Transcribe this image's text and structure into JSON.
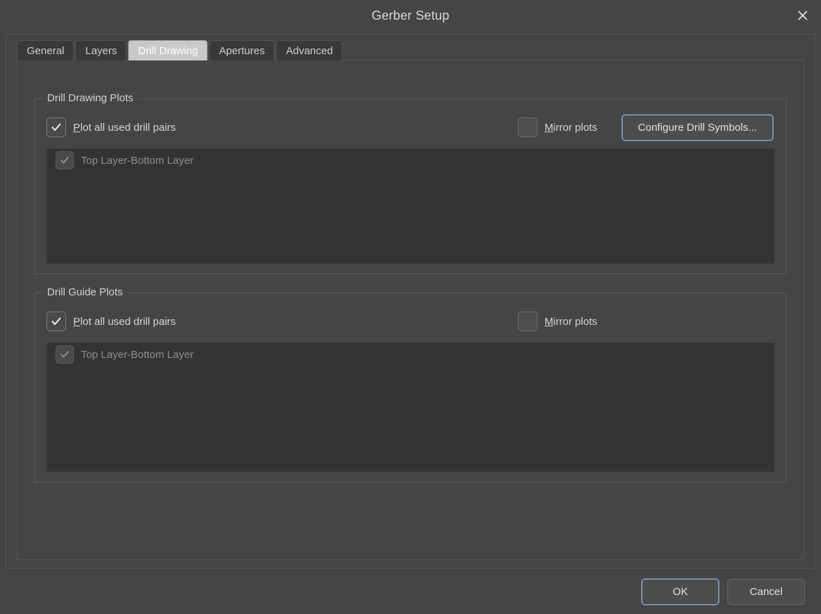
{
  "window": {
    "title": "Gerber Setup",
    "close_icon": "close-icon"
  },
  "tabs": [
    {
      "label": "General",
      "active": false
    },
    {
      "label": "Layers",
      "active": false
    },
    {
      "label": "Drill Drawing",
      "active": true
    },
    {
      "label": "Apertures",
      "active": false
    },
    {
      "label": "Advanced",
      "active": false
    }
  ],
  "drill_drawing_plots": {
    "title": "Drill Drawing Plots",
    "plot_all": {
      "label_prefix": "",
      "accel": "P",
      "label_rest": "lot all used drill pairs",
      "checked": true
    },
    "mirror": {
      "accel": "M",
      "label_rest": "irror plots",
      "checked": false
    },
    "configure_button": "Configure Drill Symbols...",
    "list": [
      {
        "label": "Top Layer-Bottom Layer",
        "checked": true,
        "disabled": true
      }
    ]
  },
  "drill_guide_plots": {
    "title": "Drill Guide Plots",
    "plot_all": {
      "accel": "P",
      "label_rest": "lot all used drill pairs",
      "checked": true
    },
    "mirror": {
      "accel": "M",
      "label_rest": "irror plots",
      "checked": false
    },
    "list": [
      {
        "label": "Top Layer-Bottom Layer",
        "checked": true,
        "disabled": true
      }
    ]
  },
  "footer": {
    "ok_label": "OK",
    "cancel_label": "Cancel"
  },
  "colors": {
    "dialog_bg": "#454545",
    "panel_bg": "#3c3c3c",
    "list_bg": "#333333",
    "text": "#d6d6d6",
    "disabled_text": "#8e8e8e",
    "focus_blue": "#8ab4e8",
    "tab_active_bg": "#c9c9c9"
  }
}
